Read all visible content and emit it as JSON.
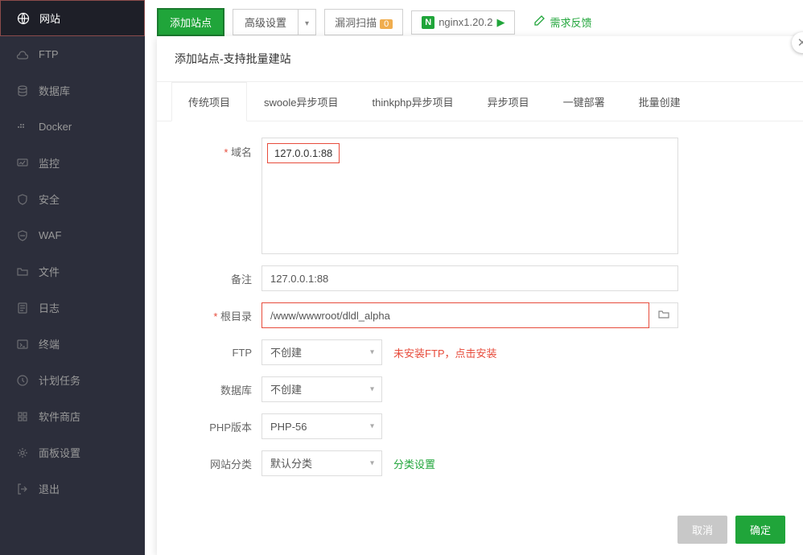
{
  "sidebar": {
    "items": [
      {
        "label": "网站"
      },
      {
        "label": "FTP"
      },
      {
        "label": "数据库"
      },
      {
        "label": "Docker"
      },
      {
        "label": "监控"
      },
      {
        "label": "安全"
      },
      {
        "label": "WAF"
      },
      {
        "label": "文件"
      },
      {
        "label": "日志"
      },
      {
        "label": "终端"
      },
      {
        "label": "计划任务"
      },
      {
        "label": "软件商店"
      },
      {
        "label": "面板设置"
      },
      {
        "label": "退出"
      }
    ]
  },
  "toolbar": {
    "add_site": "添加站点",
    "advanced": "高级设置",
    "scan": "漏洞扫描",
    "scan_count": "0",
    "nginx": "nginx1.20.2",
    "feedback": "需求反馈"
  },
  "modal": {
    "title": "添加站点-支持批量建站",
    "tabs": [
      "传统项目",
      "swoole异步项目",
      "thinkphp异步项目",
      "异步项目",
      "一键部署",
      "批量创建"
    ],
    "labels": {
      "domain": "域名",
      "note": "备注",
      "root": "根目录",
      "ftp": "FTP",
      "db": "数据库",
      "php": "PHP版本",
      "category": "网站分类"
    },
    "values": {
      "domain": "127.0.0.1:88",
      "note": "127.0.0.1:88",
      "root": "/www/wwwroot/dldl_alpha",
      "ftp": "不创建",
      "db": "不创建",
      "php": "PHP-56",
      "category": "默认分类"
    },
    "hints": {
      "ftp_warn": "未安装FTP，点击安装",
      "category_link": "分类设置"
    },
    "buttons": {
      "cancel": "取消",
      "confirm": "确定"
    }
  }
}
